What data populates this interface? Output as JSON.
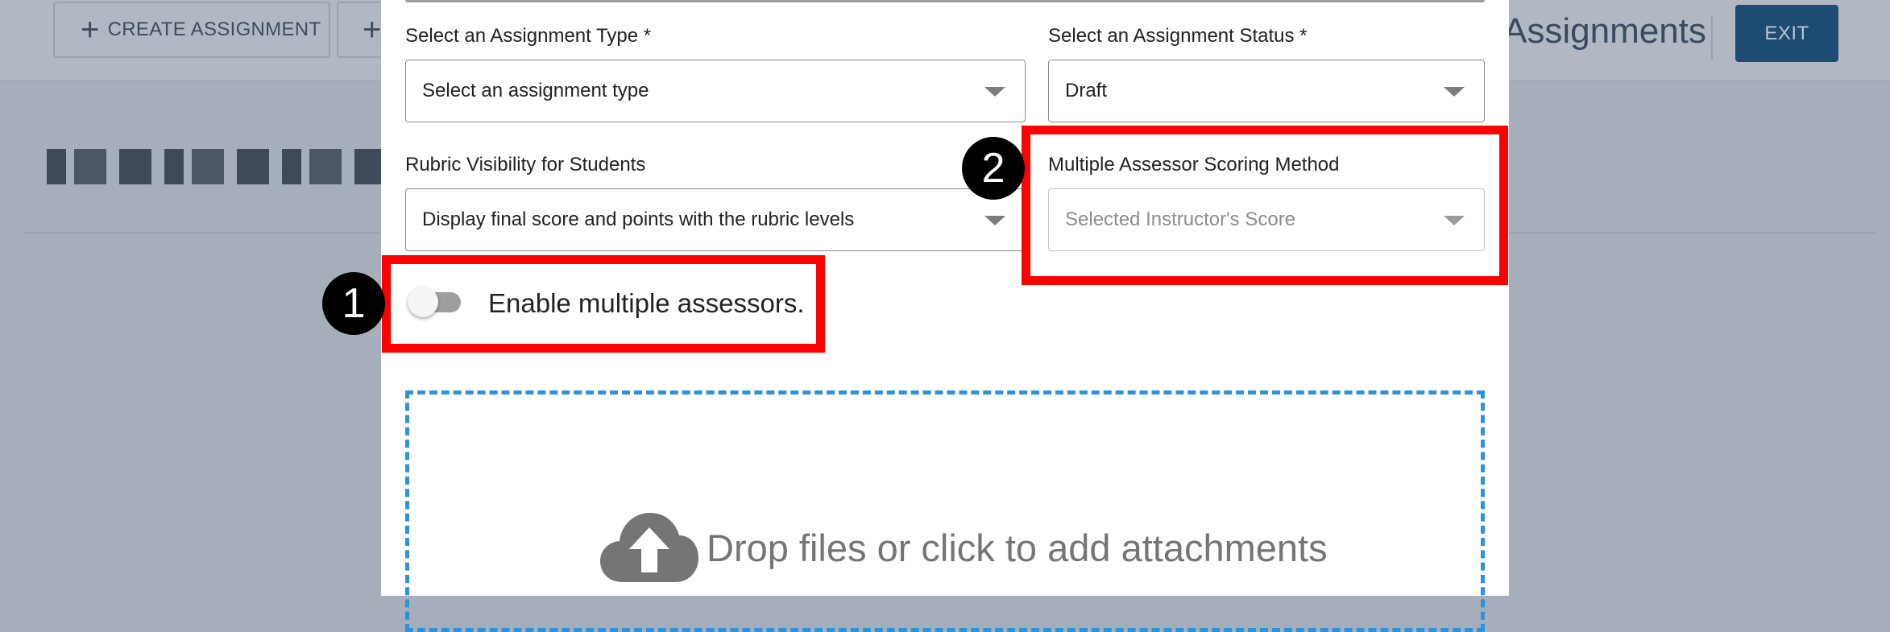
{
  "background": {
    "toolbar": {
      "create_assignment_label": "CREATE ASSIGNMENT",
      "second_button_plus": "+",
      "page_title_partial": "Assignments",
      "exit_label": "EXIT"
    }
  },
  "modal": {
    "assignment_type": {
      "label": "Select an Assignment Type *",
      "value": "Select an assignment type"
    },
    "assignment_status": {
      "label": "Select an Assignment Status *",
      "value": "Draft"
    },
    "rubric_visibility": {
      "label": "Rubric Visibility for Students",
      "value": "Display final score and points with the rubric levels"
    },
    "scoring_method": {
      "label": "Multiple Assessor Scoring Method",
      "value": "Selected Instructor's Score",
      "disabled": true
    },
    "multiple_assessors_toggle": {
      "label": "Enable multiple assessors.",
      "enabled": false
    },
    "dropzone": {
      "text": "Drop files or click to add attachments",
      "icon": "cloud-upload-icon"
    }
  },
  "callouts": [
    {
      "number": "1",
      "target": "multiple-assessors-toggle"
    },
    {
      "number": "2",
      "target": "scoring-method-select"
    }
  ],
  "colors": {
    "highlight": "#ff0000",
    "dropzone_border": "#2b93db",
    "exit_button": "#1d4b72"
  }
}
